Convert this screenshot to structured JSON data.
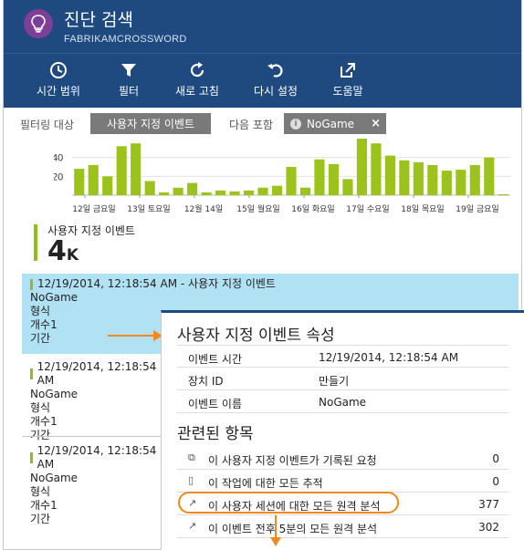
{
  "header": {
    "title": "진단 검색",
    "subtitle": "FABRIKAMCROSSWORD",
    "brand_color": "#1e4a80",
    "icon": "lightbulb-icon"
  },
  "toolbar": [
    {
      "label": "시간 범위",
      "icon": "clock-icon"
    },
    {
      "label": "필터",
      "icon": "filter-icon"
    },
    {
      "label": "새로 고침",
      "icon": "refresh-icon"
    },
    {
      "label": "다시 설정",
      "icon": "undo-icon"
    },
    {
      "label": "도움말",
      "icon": "external-link-icon"
    }
  ],
  "filters": {
    "target_label": "필터링 대상",
    "target_value": "사용자 지정 이벤트",
    "include_label": "다음 포함",
    "include_value": "NoGame",
    "info_icon": "info-icon",
    "remove_icon": "close-icon"
  },
  "chart_data": {
    "type": "bar",
    "color": "#9bc31c",
    "ylim": [
      0,
      60
    ],
    "yticks": [
      20,
      40
    ],
    "x_tick_labels": [
      "12일 금요일",
      "13일 토요일",
      "12월 14일",
      "15일 월요일",
      "16일 화요일",
      "17일 수요일",
      "18일 목요일",
      "19일 금요일"
    ],
    "values": [
      28,
      32,
      20,
      52,
      55,
      15,
      3,
      8,
      13,
      3,
      5,
      4,
      5,
      8,
      10,
      30,
      8,
      38,
      33,
      17,
      60,
      55,
      42,
      37,
      35,
      32,
      26,
      27,
      32,
      40,
      1
    ]
  },
  "summary": {
    "label": "사용자 지정 이벤트",
    "value": "4",
    "unit": "K"
  },
  "events": [
    {
      "timestamp": "12/19/2014, 12:18:54 AM - 사용자 지정 이벤트",
      "lines": [
        "NoGame",
        "형식",
        "개수1",
        "기간"
      ]
    },
    {
      "timestamp": "12/19/2014, 12:18:54 AM",
      "lines": [
        "NoGame",
        "형식",
        "개수1",
        "기간"
      ]
    },
    {
      "timestamp": "12/19/2014, 12:18:54 AM",
      "lines": [
        "NoGame",
        "형식",
        "개수1",
        "기간"
      ]
    }
  ],
  "detail": {
    "title": "사용자 지정 이벤트 속성",
    "properties": [
      {
        "key": "이벤트 시간",
        "value": "12/19/2014, 12:18:54 AM"
      },
      {
        "key": "장치 ID",
        "value": "만들기"
      },
      {
        "key": "이벤트 이름",
        "value": "NoGame"
      }
    ],
    "related_title": "관련된 항목",
    "related": [
      {
        "label": "이 사용자 지정 이벤트가 기록된 요청",
        "count": "0",
        "icon": "request-icon"
      },
      {
        "label": "이 작업에 대한 모든 추적",
        "count": "0",
        "icon": "document-icon"
      },
      {
        "label": "이 사용자 세션에 대한 모든 원격 분석",
        "count": "377",
        "icon": "trend-arrow-icon"
      },
      {
        "label": "이 이벤트 전후 5분의 모든 원격 분석",
        "count": "302",
        "icon": "trend-arrow-icon"
      }
    ]
  },
  "annotation_color": "#f08a1c"
}
